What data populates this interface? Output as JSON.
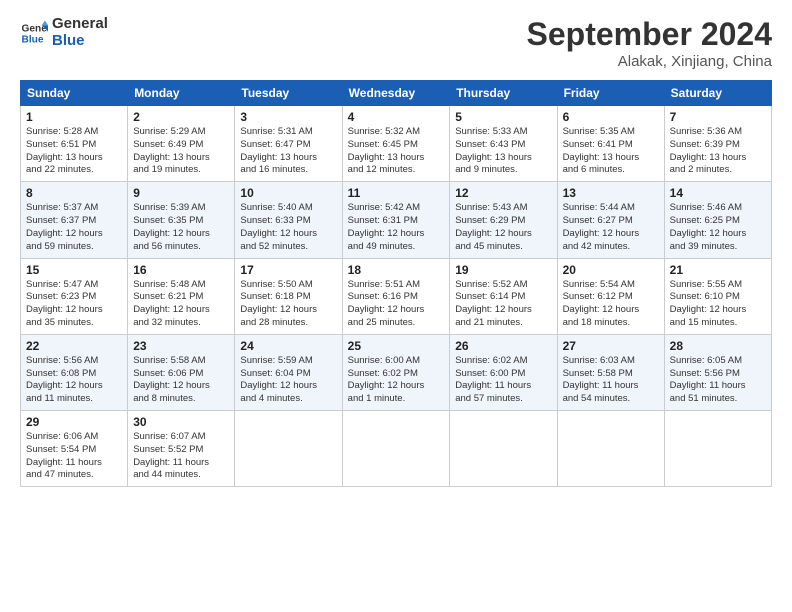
{
  "header": {
    "logo_line1": "General",
    "logo_line2": "Blue",
    "month": "September 2024",
    "location": "Alakak, Xinjiang, China"
  },
  "weekdays": [
    "Sunday",
    "Monday",
    "Tuesday",
    "Wednesday",
    "Thursday",
    "Friday",
    "Saturday"
  ],
  "weeks": [
    [
      {
        "day": "1",
        "info": "Sunrise: 5:28 AM\nSunset: 6:51 PM\nDaylight: 13 hours\nand 22 minutes."
      },
      {
        "day": "2",
        "info": "Sunrise: 5:29 AM\nSunset: 6:49 PM\nDaylight: 13 hours\nand 19 minutes."
      },
      {
        "day": "3",
        "info": "Sunrise: 5:31 AM\nSunset: 6:47 PM\nDaylight: 13 hours\nand 16 minutes."
      },
      {
        "day": "4",
        "info": "Sunrise: 5:32 AM\nSunset: 6:45 PM\nDaylight: 13 hours\nand 12 minutes."
      },
      {
        "day": "5",
        "info": "Sunrise: 5:33 AM\nSunset: 6:43 PM\nDaylight: 13 hours\nand 9 minutes."
      },
      {
        "day": "6",
        "info": "Sunrise: 5:35 AM\nSunset: 6:41 PM\nDaylight: 13 hours\nand 6 minutes."
      },
      {
        "day": "7",
        "info": "Sunrise: 5:36 AM\nSunset: 6:39 PM\nDaylight: 13 hours\nand 2 minutes."
      }
    ],
    [
      {
        "day": "8",
        "info": "Sunrise: 5:37 AM\nSunset: 6:37 PM\nDaylight: 12 hours\nand 59 minutes."
      },
      {
        "day": "9",
        "info": "Sunrise: 5:39 AM\nSunset: 6:35 PM\nDaylight: 12 hours\nand 56 minutes."
      },
      {
        "day": "10",
        "info": "Sunrise: 5:40 AM\nSunset: 6:33 PM\nDaylight: 12 hours\nand 52 minutes."
      },
      {
        "day": "11",
        "info": "Sunrise: 5:42 AM\nSunset: 6:31 PM\nDaylight: 12 hours\nand 49 minutes."
      },
      {
        "day": "12",
        "info": "Sunrise: 5:43 AM\nSunset: 6:29 PM\nDaylight: 12 hours\nand 45 minutes."
      },
      {
        "day": "13",
        "info": "Sunrise: 5:44 AM\nSunset: 6:27 PM\nDaylight: 12 hours\nand 42 minutes."
      },
      {
        "day": "14",
        "info": "Sunrise: 5:46 AM\nSunset: 6:25 PM\nDaylight: 12 hours\nand 39 minutes."
      }
    ],
    [
      {
        "day": "15",
        "info": "Sunrise: 5:47 AM\nSunset: 6:23 PM\nDaylight: 12 hours\nand 35 minutes."
      },
      {
        "day": "16",
        "info": "Sunrise: 5:48 AM\nSunset: 6:21 PM\nDaylight: 12 hours\nand 32 minutes."
      },
      {
        "day": "17",
        "info": "Sunrise: 5:50 AM\nSunset: 6:18 PM\nDaylight: 12 hours\nand 28 minutes."
      },
      {
        "day": "18",
        "info": "Sunrise: 5:51 AM\nSunset: 6:16 PM\nDaylight: 12 hours\nand 25 minutes."
      },
      {
        "day": "19",
        "info": "Sunrise: 5:52 AM\nSunset: 6:14 PM\nDaylight: 12 hours\nand 21 minutes."
      },
      {
        "day": "20",
        "info": "Sunrise: 5:54 AM\nSunset: 6:12 PM\nDaylight: 12 hours\nand 18 minutes."
      },
      {
        "day": "21",
        "info": "Sunrise: 5:55 AM\nSunset: 6:10 PM\nDaylight: 12 hours\nand 15 minutes."
      }
    ],
    [
      {
        "day": "22",
        "info": "Sunrise: 5:56 AM\nSunset: 6:08 PM\nDaylight: 12 hours\nand 11 minutes."
      },
      {
        "day": "23",
        "info": "Sunrise: 5:58 AM\nSunset: 6:06 PM\nDaylight: 12 hours\nand 8 minutes."
      },
      {
        "day": "24",
        "info": "Sunrise: 5:59 AM\nSunset: 6:04 PM\nDaylight: 12 hours\nand 4 minutes."
      },
      {
        "day": "25",
        "info": "Sunrise: 6:00 AM\nSunset: 6:02 PM\nDaylight: 12 hours\nand 1 minute."
      },
      {
        "day": "26",
        "info": "Sunrise: 6:02 AM\nSunset: 6:00 PM\nDaylight: 11 hours\nand 57 minutes."
      },
      {
        "day": "27",
        "info": "Sunrise: 6:03 AM\nSunset: 5:58 PM\nDaylight: 11 hours\nand 54 minutes."
      },
      {
        "day": "28",
        "info": "Sunrise: 6:05 AM\nSunset: 5:56 PM\nDaylight: 11 hours\nand 51 minutes."
      }
    ],
    [
      {
        "day": "29",
        "info": "Sunrise: 6:06 AM\nSunset: 5:54 PM\nDaylight: 11 hours\nand 47 minutes."
      },
      {
        "day": "30",
        "info": "Sunrise: 6:07 AM\nSunset: 5:52 PM\nDaylight: 11 hours\nand 44 minutes."
      },
      {
        "day": "",
        "info": ""
      },
      {
        "day": "",
        "info": ""
      },
      {
        "day": "",
        "info": ""
      },
      {
        "day": "",
        "info": ""
      },
      {
        "day": "",
        "info": ""
      }
    ]
  ]
}
